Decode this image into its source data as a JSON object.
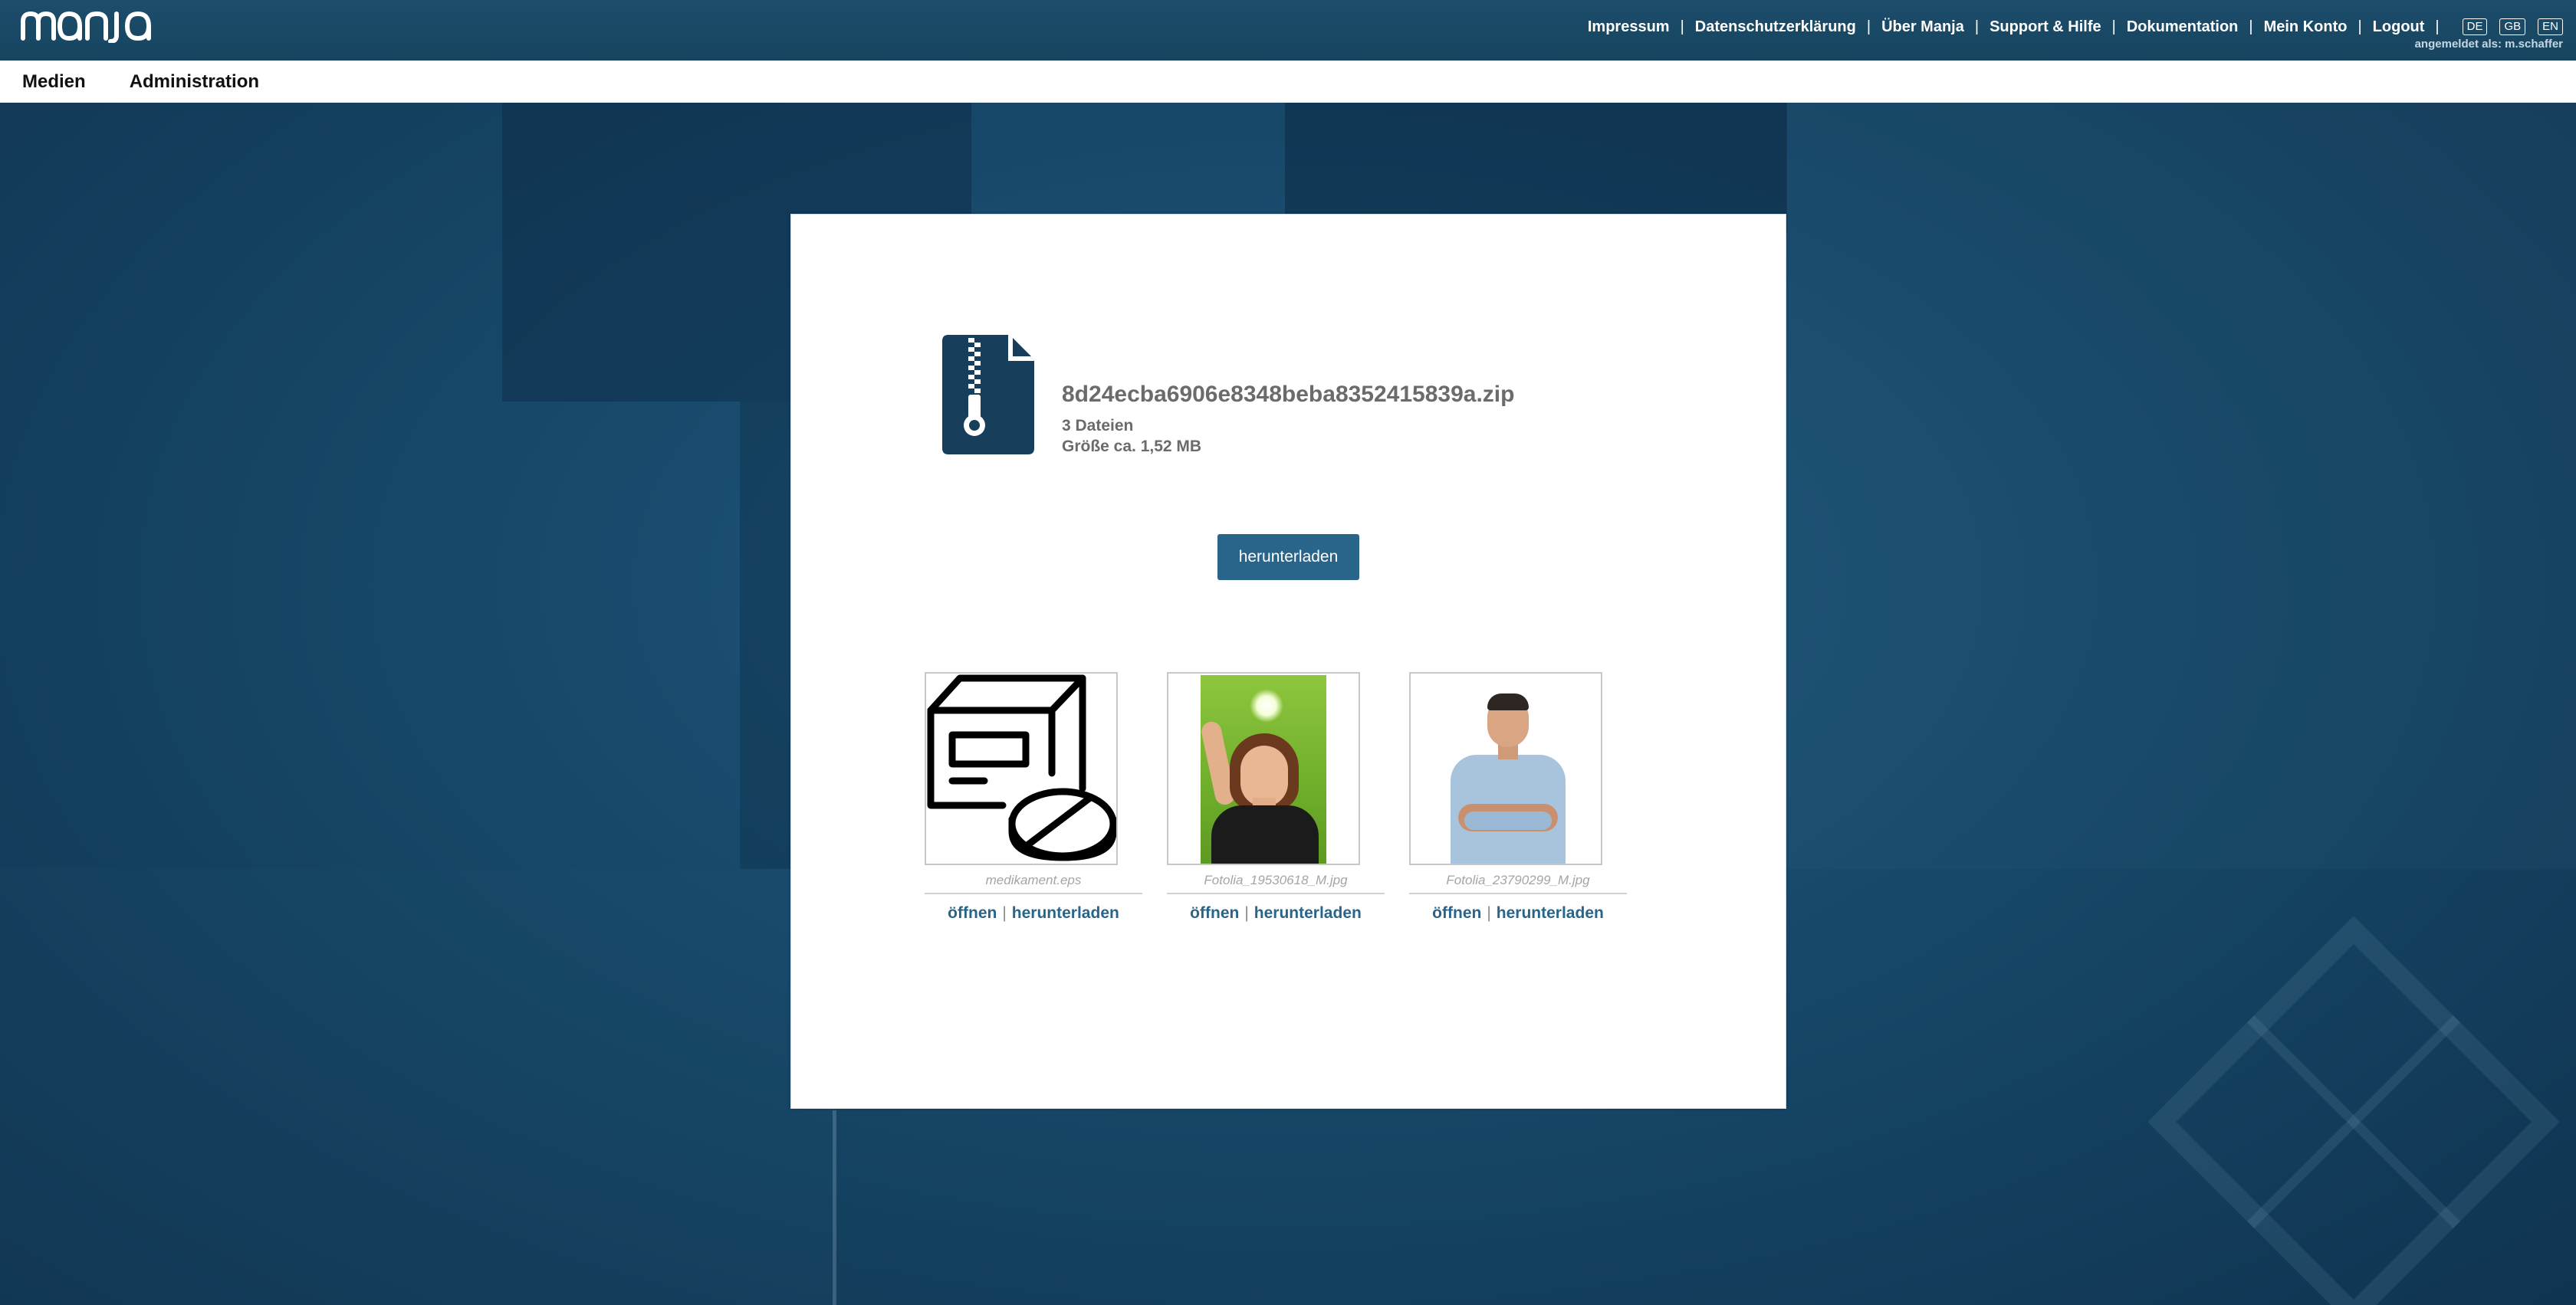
{
  "header": {
    "logo_text": "manja",
    "nav": [
      {
        "label": "Impressum"
      },
      {
        "label": "Datenschutzerklärung"
      },
      {
        "label": "Über Manja"
      },
      {
        "label": "Support & Hilfe"
      },
      {
        "label": "Dokumentation"
      },
      {
        "label": "Mein Konto"
      },
      {
        "label": "Logout"
      }
    ],
    "separator": "|",
    "languages": [
      "DE",
      "GB",
      "EN"
    ],
    "logged_in_as": "angemeldet als: m.schaffer"
  },
  "secondary_nav": {
    "items": [
      {
        "label": "Medien"
      },
      {
        "label": "Administration"
      }
    ]
  },
  "download": {
    "icon": "zip-file-icon",
    "filename": "8d24ecba6906e8348beba8352415839a.zip",
    "file_count": "3 Dateien",
    "size": "Größe ca. 1,52 MB",
    "button_label": "herunterladen"
  },
  "files": [
    {
      "name": "medikament.eps",
      "thumb": "medication-box-pill-icon",
      "open_label": "öffnen",
      "download_label": "herunterladen"
    },
    {
      "name": "Fotolia_19530618_M.jpg",
      "thumb": "woman-lightbulb-photo",
      "open_label": "öffnen",
      "download_label": "herunterladen"
    },
    {
      "name": "Fotolia_23790299_M.jpg",
      "thumb": "man-crossed-arms-photo",
      "open_label": "öffnen",
      "download_label": "herunterladen"
    }
  ],
  "pipe": "|",
  "colors": {
    "topbar": "#1c4d6b",
    "accent": "#29658a",
    "background": "#17486a"
  }
}
